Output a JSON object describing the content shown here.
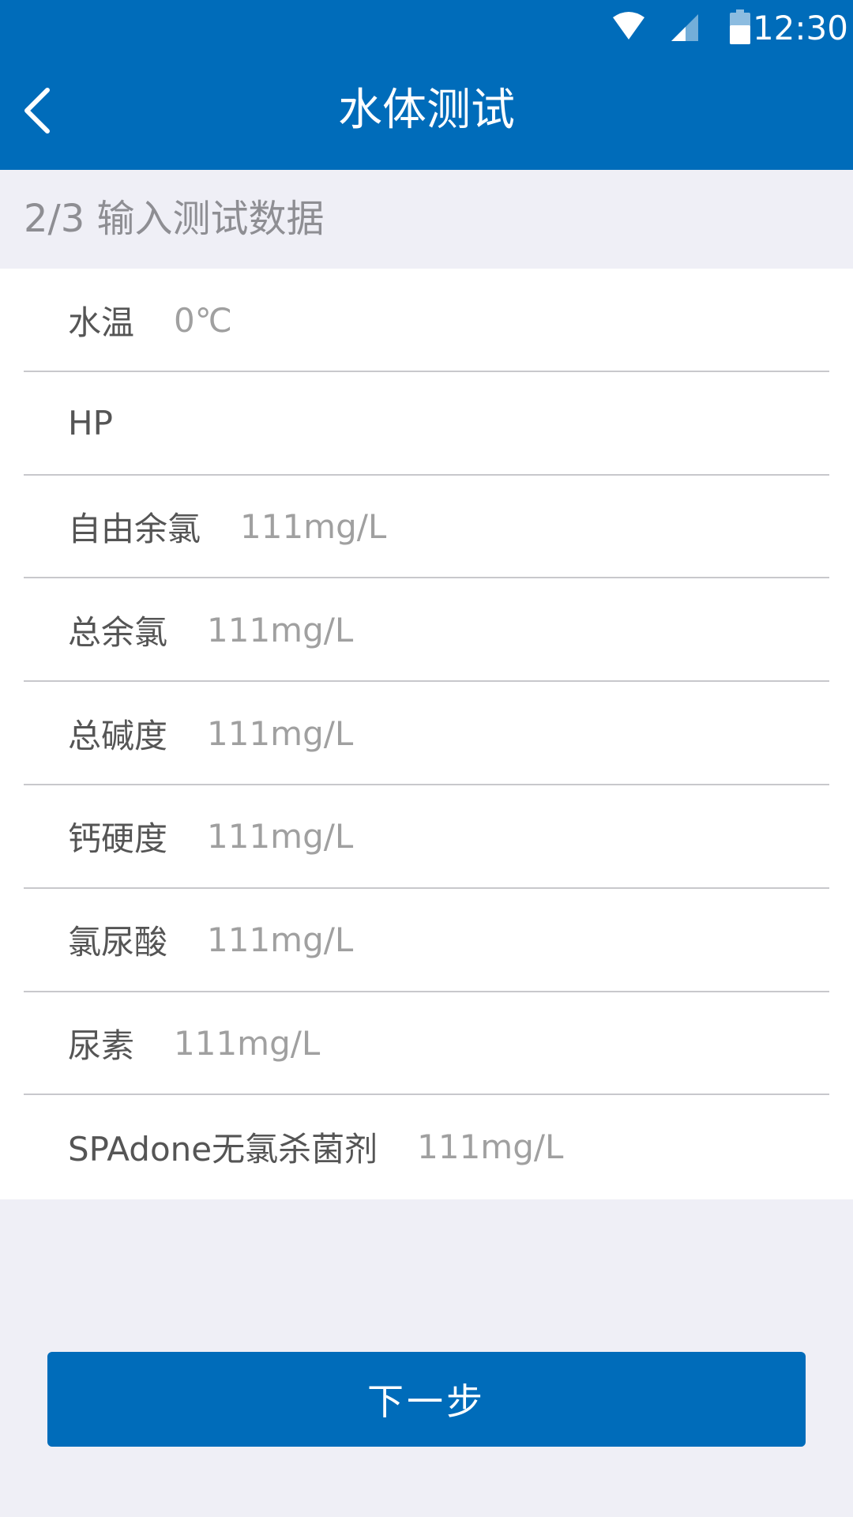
{
  "status_bar": {
    "time": "12:30",
    "icons": [
      "wifi-icon",
      "cellular-signal-icon",
      "battery-icon"
    ]
  },
  "header": {
    "title": "水体测试",
    "back_icon": "chevron-left-icon"
  },
  "section": {
    "label": "2/3 输入测试数据"
  },
  "fields": [
    {
      "label": "水温",
      "value": "0℃"
    },
    {
      "label": "HP",
      "value": ""
    },
    {
      "label": "自由余氯",
      "value": "111mg/L"
    },
    {
      "label": "总余氯",
      "value": "111mg/L"
    },
    {
      "label": "总碱度",
      "value": "111mg/L"
    },
    {
      "label": "钙硬度",
      "value": "111mg/L"
    },
    {
      "label": "氯尿酸",
      "value": "111mg/L"
    },
    {
      "label": "尿素",
      "value": "111mg/L"
    },
    {
      "label": "SPAdone无氯杀菌剂",
      "value": "111mg/L"
    }
  ],
  "footer": {
    "next_label": "下一步"
  },
  "colors": {
    "primary": "#006CBA",
    "background": "#EFEFF6",
    "row_background": "#FFFFFF",
    "label_text": "#555555",
    "value_text": "#A0A0A0",
    "divider": "#C8C8CC",
    "header_text": "#8E8E93"
  }
}
